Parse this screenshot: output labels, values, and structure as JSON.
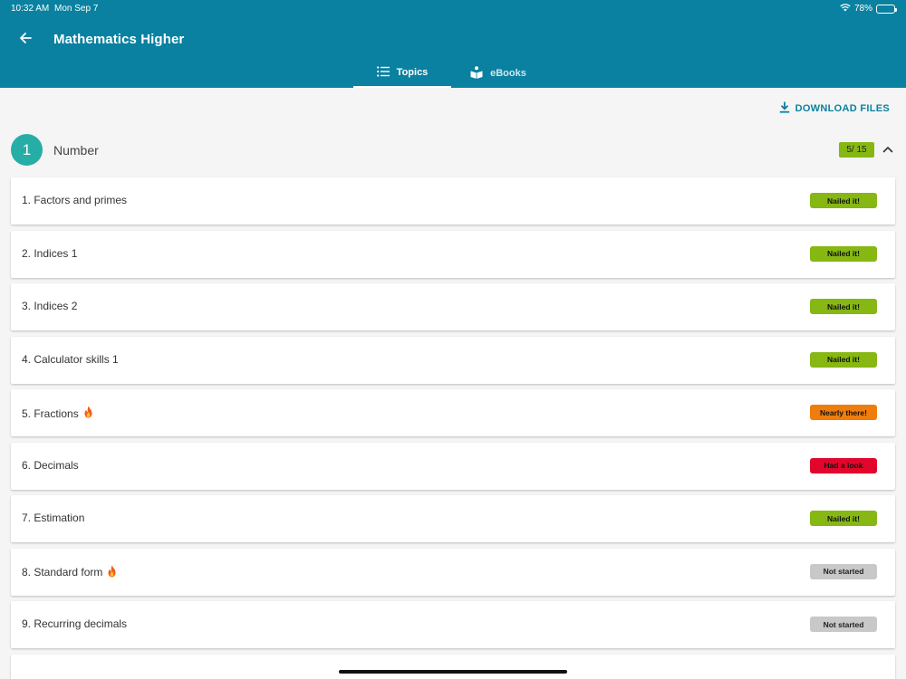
{
  "status_bar": {
    "time": "10:32 AM",
    "date": "Mon Sep 7",
    "battery": "78%",
    "battery_level": 0.78
  },
  "header": {
    "title": "Mathematics Higher",
    "back_icon": "arrow-left-icon"
  },
  "tabs": [
    {
      "label": "Topics",
      "icon": "list-icon",
      "active": true
    },
    {
      "label": "eBooks",
      "icon": "book-reader-icon",
      "active": false
    }
  ],
  "download": {
    "label": "DOWNLOAD FILES",
    "icon": "download-icon"
  },
  "section": {
    "number": "1",
    "title": "Number",
    "progress": "5/ 15",
    "expanded": true
  },
  "topics": [
    {
      "label": "1. Factors and primes",
      "flame": false,
      "status": "Nailed it!",
      "status_color": "#86b712",
      "text_color": "#111111"
    },
    {
      "label": "2. Indices 1",
      "flame": false,
      "status": "Nailed it!",
      "status_color": "#86b712",
      "text_color": "#111111"
    },
    {
      "label": "3. Indices 2",
      "flame": false,
      "status": "Nailed it!",
      "status_color": "#86b712",
      "text_color": "#111111"
    },
    {
      "label": "4. Calculator skills 1",
      "flame": false,
      "status": "Nailed it!",
      "status_color": "#86b712",
      "text_color": "#111111"
    },
    {
      "label": "5. Fractions",
      "flame": true,
      "status": "Nearly there!",
      "status_color": "#ef7d0b",
      "text_color": "#111111"
    },
    {
      "label": "6. Decimals",
      "flame": false,
      "status": "Had a look",
      "status_color": "#e2062c",
      "text_color": "#111111"
    },
    {
      "label": "7. Estimation",
      "flame": false,
      "status": "Nailed it!",
      "status_color": "#86b712",
      "text_color": "#111111"
    },
    {
      "label": "8. Standard form",
      "flame": true,
      "status": "Not started",
      "status_color": "#c8c8c8",
      "text_color": "#222222"
    },
    {
      "label": "9. Recurring decimals",
      "flame": false,
      "status": "Not started",
      "status_color": "#c8c8c8",
      "text_color": "#222222"
    },
    {
      "label": "",
      "flame": false,
      "status": "",
      "status_color": "",
      "text_color": ""
    }
  ],
  "colors": {
    "header": "#0a81a1",
    "accent": "#0a81a1",
    "section_circle": "#26aea6",
    "background": "#f5f5f5"
  }
}
